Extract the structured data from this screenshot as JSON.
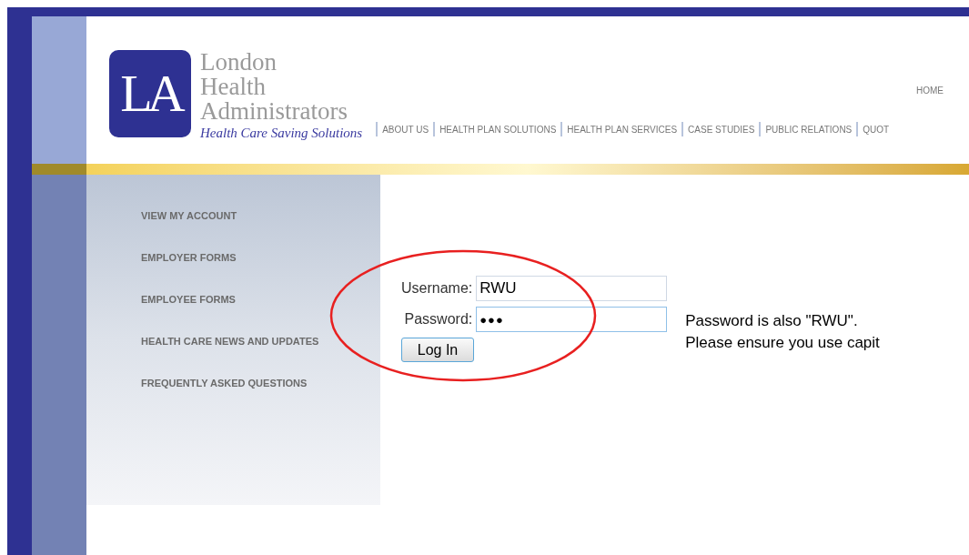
{
  "logo": {
    "mark": "LA",
    "name_lines": [
      "London",
      "Health",
      "Administrators"
    ],
    "tagline": "Health Care Saving Solutions"
  },
  "top_links": [
    "HOME"
  ],
  "nav": [
    "ABOUT US",
    "HEALTH PLAN SOLUTIONS",
    "HEALTH PLAN SERVICES",
    "CASE STUDIES",
    "PUBLIC RELATIONS",
    "QUOT"
  ],
  "sidebar": {
    "items": [
      "VIEW MY ACCOUNT",
      "EMPLOYER FORMS",
      "EMPLOYEE FORMS",
      "HEALTH CARE NEWS AND UPDATES",
      "FREQUENTLY ASKED QUESTIONS"
    ]
  },
  "login": {
    "username_label": "Username:",
    "username": "RWU",
    "password_label": "Password:",
    "password": "●●●",
    "button": "Log In"
  },
  "note": [
    "Password is also \"RWU\".",
    "Please ensure you use capit"
  ]
}
